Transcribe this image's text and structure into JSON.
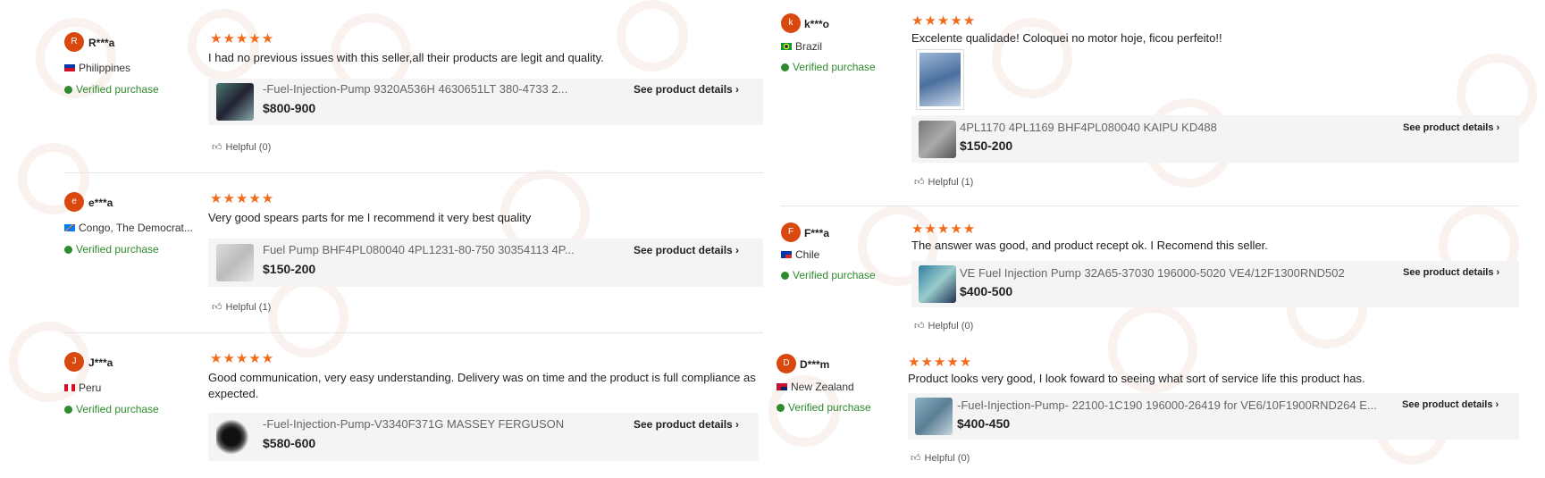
{
  "colors": {
    "accent": "#f26a1b",
    "avatar": "#d9480f",
    "verified": "#2e8b2e",
    "card": "#f4f4f4"
  },
  "icons": {
    "verified": "check-circle-icon",
    "helpful": "thumbs-up-icon",
    "chevron": "chevron-right-icon",
    "star": "star-icon"
  },
  "reviews": [
    {
      "initial": "R",
      "name": "R***a",
      "country": "Philippines",
      "verified": "Verified purchase",
      "stars": "★★★★★",
      "text": "I had no previous issues with this seller,all their products are legit and quality.",
      "product": "-Fuel-Injection-Pump 9320A536H 4630651LT 380-4733 2...",
      "price": "$800-900",
      "details": "See product details",
      "helpful": "Helpful (0)"
    },
    {
      "initial": "e",
      "name": "e***a",
      "country": "Congo, The Democrat...",
      "verified": "Verified purchase",
      "stars": "★★★★★",
      "text": "Very good spears parts for me I recommend it very best quality",
      "product": "Fuel Pump BHF4PL080040 4PL1231-80-750 30354113 4P...",
      "price": "$150-200",
      "details": "See product details",
      "helpful": "Helpful (1)"
    },
    {
      "initial": "J",
      "name": "J***a",
      "country": "Peru",
      "verified": "Verified purchase",
      "stars": "★★★★★",
      "text": "Good communication, very easy understanding. Delivery was on time and the product is full compliance as expected.",
      "product": "-Fuel-Injection-Pump-V3340F371G MASSEY FERGUSON",
      "price": "$580-600",
      "details": "See product details"
    },
    {
      "initial": "k",
      "name": "k***o",
      "country": "Brazil",
      "verified": "Verified purchase",
      "stars": "★★★★★",
      "text": "Excelente qualidade! Coloquei no motor hoje, ficou perfeito!!",
      "product": "4PL1170 4PL1169 BHF4PL080040 KAIPU KD488",
      "price": "$150-200",
      "details": "See product details",
      "helpful": "Helpful (1)"
    },
    {
      "initial": "F",
      "name": "F***a",
      "country": "Chile",
      "verified": "Verified purchase",
      "stars": "★★★★★",
      "text": "The answer was good, and product recept ok. I Recomend this seller.",
      "product": "VE Fuel Injection Pump 32A65-37030 196000-5020 VE4/12F1300RND502",
      "price": "$400-500",
      "details": "See product details",
      "helpful": "Helpful (0)"
    },
    {
      "initial": "D",
      "name": "D***m",
      "country": "New Zealand",
      "verified": "Verified purchase",
      "stars": "★★★★★",
      "text": "Product looks very good, I look foward to seeing what sort of service life this product has.",
      "product": "-Fuel-Injection-Pump- 22100-1C190 196000-26419 for VE6/10F1900RND264 E...",
      "price": "$400-450",
      "details": "See product details",
      "helpful": "Helpful (0)"
    }
  ]
}
